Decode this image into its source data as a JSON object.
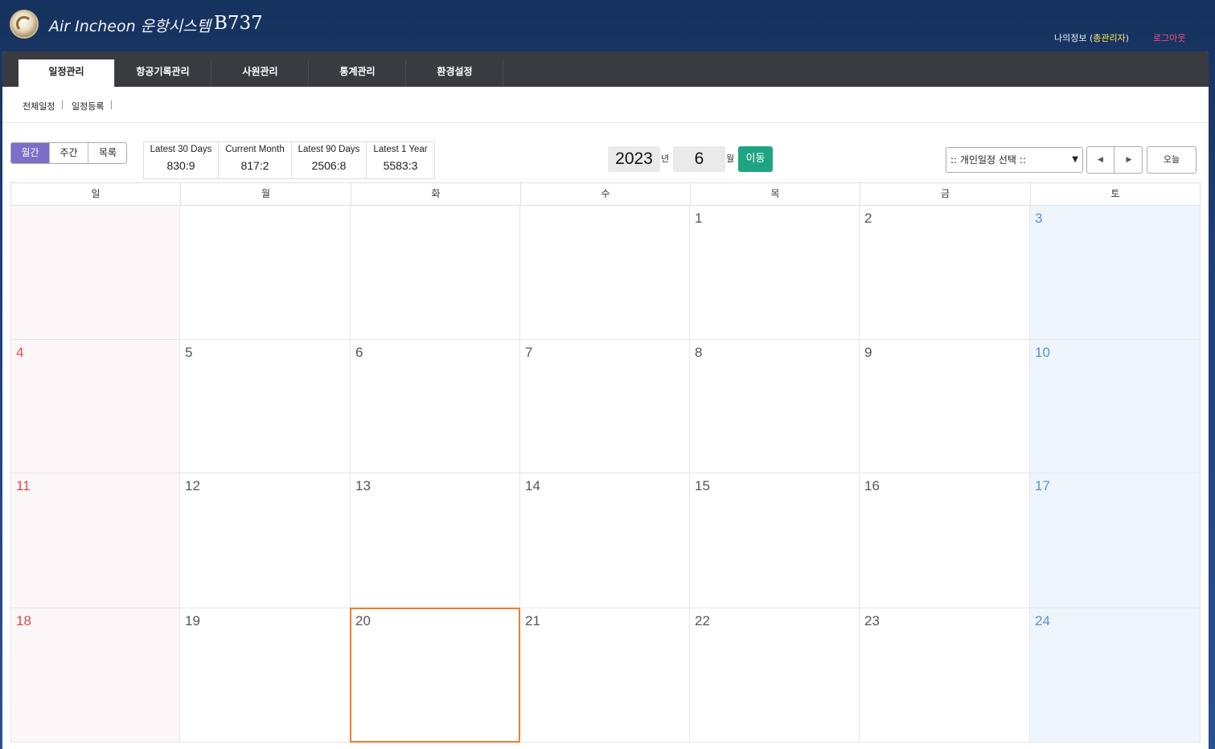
{
  "header": {
    "app_title": "Air Incheon 운항시스템",
    "model": "B737",
    "user_prefix": "나의정보 (",
    "user_name": "총관리자",
    "user_suffix": ")",
    "logout": "로그아웃"
  },
  "nav": {
    "tabs": [
      {
        "label": "일정관리",
        "active": true
      },
      {
        "label": "항공기록관리",
        "active": false
      },
      {
        "label": "사원관리",
        "active": false
      },
      {
        "label": "통계관리",
        "active": false
      },
      {
        "label": "환경설정",
        "active": false
      }
    ]
  },
  "subnav": {
    "items": [
      "전체일정",
      "일정등록"
    ]
  },
  "view_toggle": {
    "items": [
      {
        "label": "월간",
        "active": true
      },
      {
        "label": "주간",
        "active": false
      },
      {
        "label": "목록",
        "active": false
      }
    ]
  },
  "stats": [
    {
      "label": "Latest 30 Days",
      "value": "830:9"
    },
    {
      "label": "Current Month",
      "value": "817:2"
    },
    {
      "label": "Latest 90 Days",
      "value": "2506:8"
    },
    {
      "label": "Latest 1 Year",
      "value": "5583:3"
    }
  ],
  "period": {
    "year": "2023",
    "year_label": "년",
    "month": "6",
    "month_label": "월",
    "go_label": "이동"
  },
  "schedule_select": {
    "selected": ":: 개인일정 선택 ::"
  },
  "today_label": "오늘",
  "calendar": {
    "weekdays": [
      "일",
      "월",
      "화",
      "수",
      "목",
      "금",
      "토"
    ],
    "weeks": [
      [
        "",
        "",
        "",
        "",
        "1",
        "2",
        "3"
      ],
      [
        "4",
        "5",
        "6",
        "7",
        "8",
        "9",
        "10"
      ],
      [
        "11",
        "12",
        "13",
        "14",
        "15",
        "16",
        "17"
      ],
      [
        "18",
        "19",
        "20",
        "21",
        "22",
        "23",
        "24"
      ]
    ],
    "today": "20",
    "colors": {
      "sunday": "#e04848",
      "saturday": "#5a90d0",
      "today_border": "#f07c2e"
    }
  }
}
